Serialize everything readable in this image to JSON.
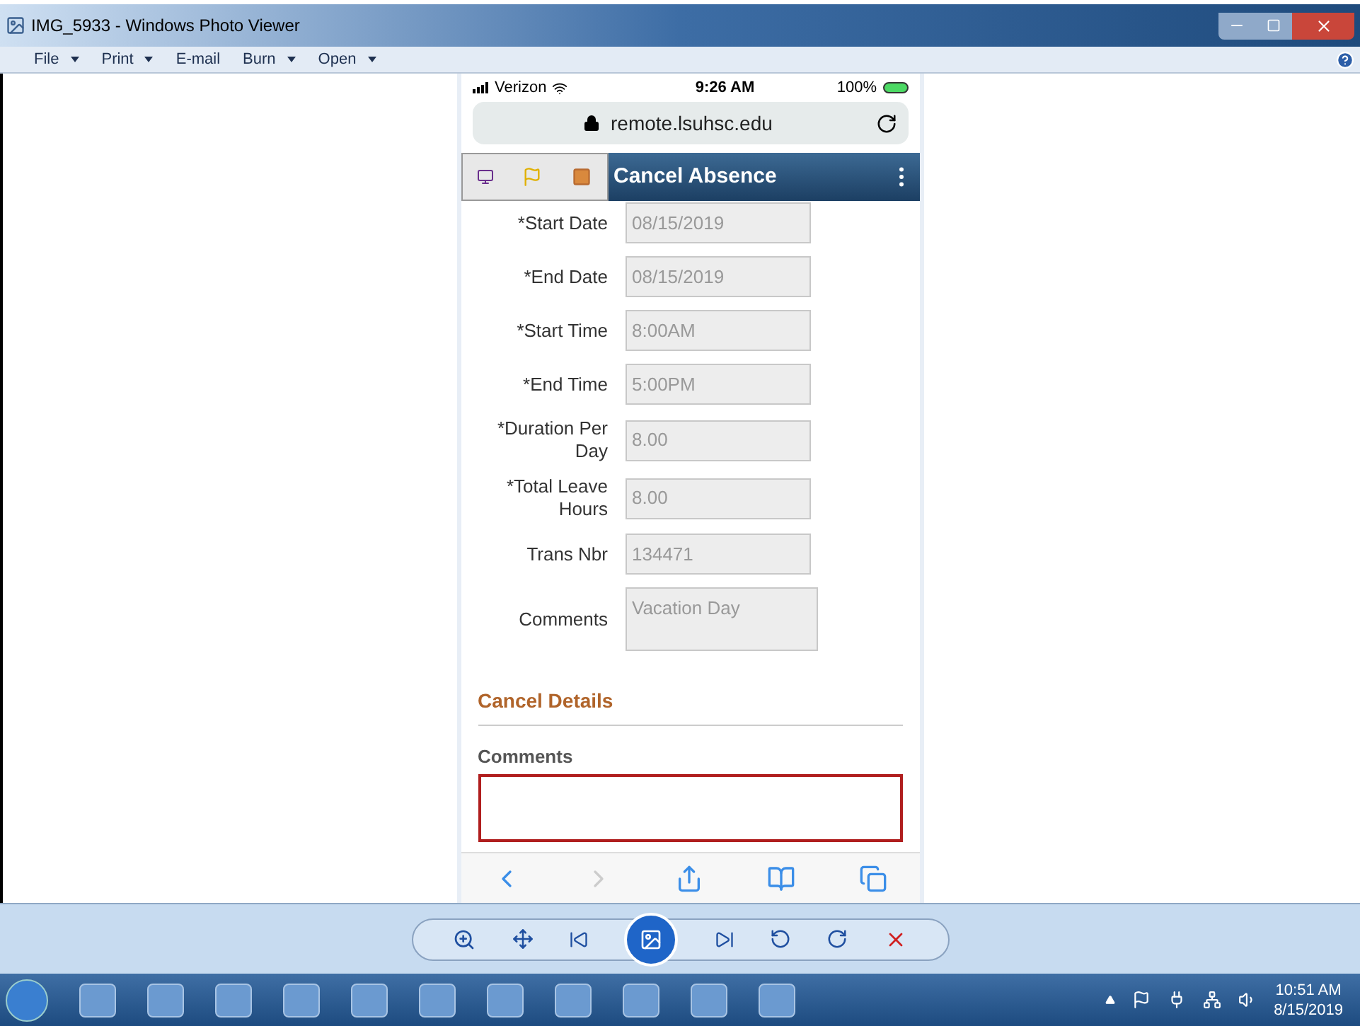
{
  "window": {
    "title": "IMG_5933 - Windows Photo Viewer"
  },
  "menu": [
    {
      "label": "File",
      "kind": "dropdown"
    },
    {
      "label": "Print",
      "kind": "dropdown"
    },
    {
      "label": "E-mail",
      "kind": "plain"
    },
    {
      "label": "Burn",
      "kind": "dropdown"
    },
    {
      "label": "Open",
      "kind": "dropdown"
    }
  ],
  "phone": {
    "status_bar": {
      "carrier": "Verizon",
      "time": "9:26 AM",
      "battery": "100%"
    },
    "address_bar": {
      "url": "remote.lsuhsc.edu"
    },
    "header": {
      "title": "Cancel Absence"
    },
    "fields": [
      {
        "label": "*Start Date",
        "value": "08/15/2019",
        "kind": "input"
      },
      {
        "label": "*End Date",
        "value": "08/15/2019",
        "kind": "input"
      },
      {
        "label": "*Start Time",
        "value": "8:00AM",
        "kind": "input"
      },
      {
        "label": "*End Time",
        "value": "5:00PM",
        "kind": "input"
      },
      {
        "label": "*Duration Per Day",
        "value": "8.00",
        "kind": "input"
      },
      {
        "label": "*Total Leave Hours",
        "value": "8.00",
        "kind": "input"
      },
      {
        "label": "Trans Nbr",
        "value": "134471",
        "kind": "input"
      },
      {
        "label": "Comments",
        "value": "Vacation Day",
        "kind": "textarea"
      }
    ],
    "section": {
      "title": "Cancel Details",
      "comments_label": "Comments"
    }
  },
  "taskbar": {
    "time": "10:51 AM",
    "date": "8/15/2019"
  }
}
